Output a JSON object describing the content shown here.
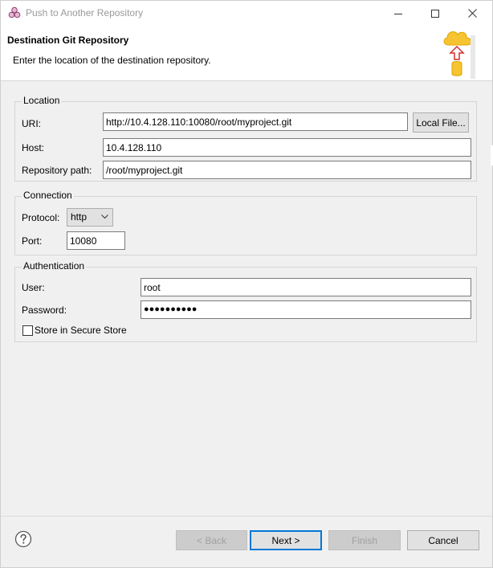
{
  "window": {
    "title": "Push to Another Repository"
  },
  "banner": {
    "heading": "Destination Git Repository",
    "description": "Enter the location of the destination repository."
  },
  "location": {
    "group_label": "Location",
    "uri_label": "URI:",
    "uri_value": "http://10.4.128.110:10080/root/myproject.git",
    "local_file_button": "Local File...",
    "host_label": "Host:",
    "host_value": "10.4.128.110",
    "repo_path_label": "Repository path:",
    "repo_path_value": "/root/myproject.git"
  },
  "connection": {
    "group_label": "Connection",
    "protocol_label": "Protocol:",
    "protocol_value": "http",
    "port_label": "Port:",
    "port_value": "10080"
  },
  "authentication": {
    "group_label": "Authentication",
    "user_label": "User:",
    "user_value": "root",
    "password_label": "Password:",
    "password_value": "●●●●●●●●●●",
    "store_label": "Store in Secure Store",
    "store_checked": false
  },
  "footer": {
    "back_button": "< Back",
    "next_button": "Next >",
    "finish_button": "Finish",
    "cancel_button": "Cancel"
  },
  "colors": {
    "default_button_border": "#0078d7",
    "title_text": "#999999",
    "disabled_text": "#a0a0a0"
  },
  "icons": {
    "app": "git-repo-icon",
    "minimize": "minimize-icon",
    "maximize": "maximize-icon",
    "close": "close-icon",
    "wizard": "cloud-upload-database-icon",
    "help": "help-icon",
    "chevron": "chevron-down-icon"
  }
}
